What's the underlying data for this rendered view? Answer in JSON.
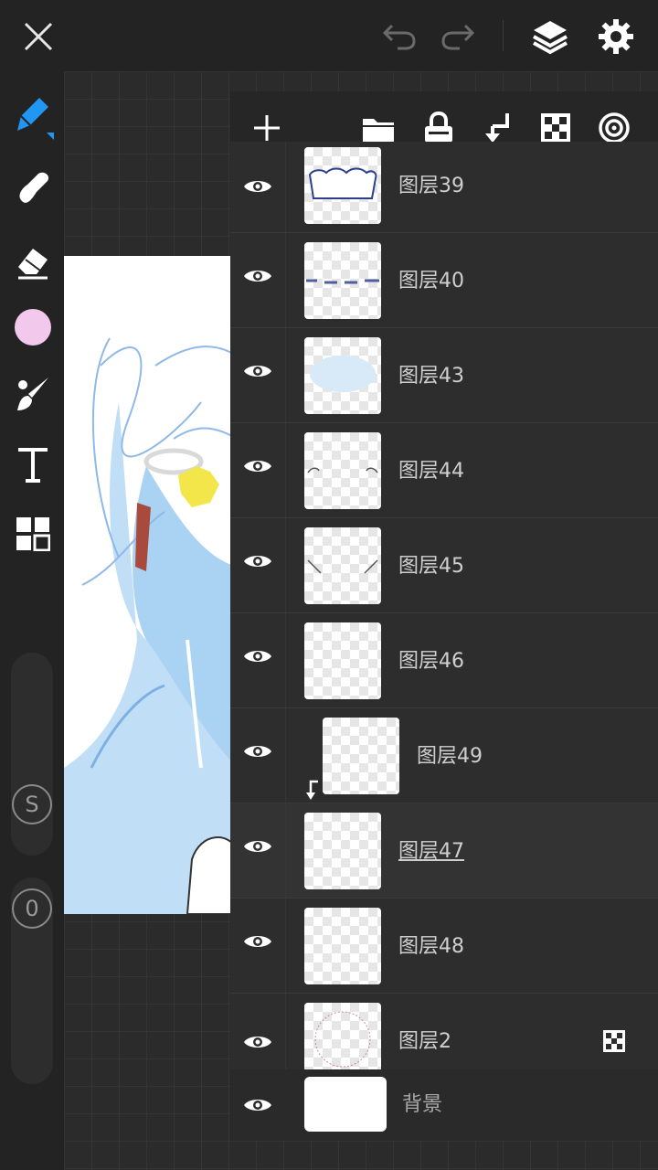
{
  "colors": {
    "accent": "#2196f3",
    "current_color": "#f2c9ec",
    "panel_bg": "#2a2a2a"
  },
  "topbar": {
    "icons": [
      "close-icon",
      "undo-icon",
      "redo-icon",
      "layers-icon",
      "settings-icon"
    ]
  },
  "sidebar": {
    "tools": [
      "pen-icon",
      "smudge-icon",
      "eraser-icon",
      "color-swatch",
      "brush-icon",
      "text-icon",
      "gallery-icon"
    ],
    "size_label": "S",
    "opacity_label": "0"
  },
  "layers_panel": {
    "toolbar_icons": [
      "add-layer-icon",
      "folder-icon",
      "lock-icon",
      "clip-icon",
      "alpha-lock-icon",
      "blend-icon"
    ],
    "layers": [
      {
        "name": "图层39"
      },
      {
        "name": "图层40"
      },
      {
        "name": "图层43"
      },
      {
        "name": "图层44"
      },
      {
        "name": "图层45"
      },
      {
        "name": "图层46"
      },
      {
        "name": "图层49",
        "clipped": true
      },
      {
        "name": "图层47",
        "selected": true
      },
      {
        "name": "图层48"
      },
      {
        "name": "图层2",
        "alpha_locked": true
      }
    ],
    "background_layer": {
      "name": "背景"
    }
  }
}
